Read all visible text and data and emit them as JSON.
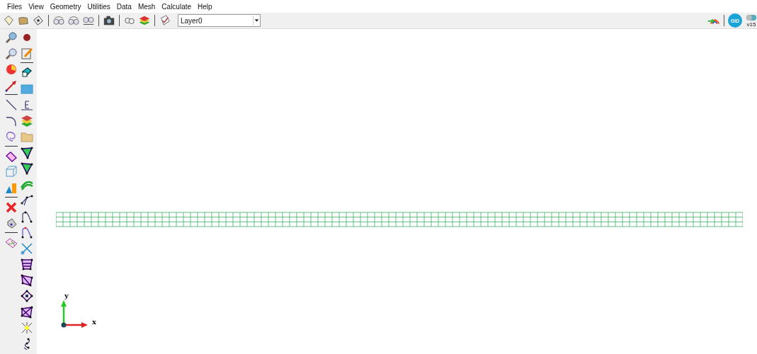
{
  "menu_bar": [
    {
      "label": "Files"
    },
    {
      "label": "View"
    },
    {
      "label": "Geometry"
    },
    {
      "label": "Utilities"
    },
    {
      "label": "Data"
    },
    {
      "label": "Mesh"
    },
    {
      "label": "Calculate"
    },
    {
      "label": "Help"
    }
  ],
  "toolbar": {
    "layer_select": {
      "value": "Layer0"
    },
    "logo": "GID",
    "version": "v15"
  },
  "axes": {
    "y_label": "y",
    "x_label": "x"
  }
}
